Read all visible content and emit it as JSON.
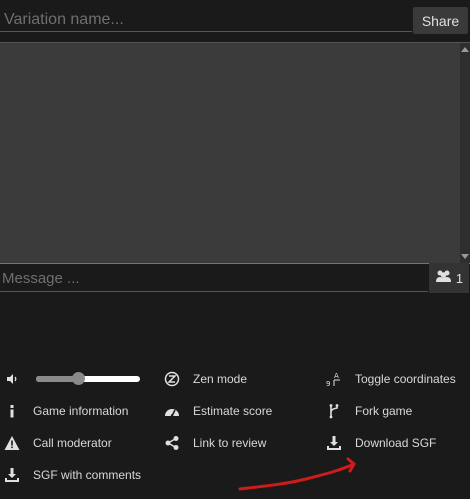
{
  "variation": {
    "placeholder": "Variation name...",
    "share_label": "Share"
  },
  "chat": {
    "message_placeholder": "Message ...",
    "user_count": "1"
  },
  "controls": {
    "zen_mode": "Zen mode",
    "toggle_coordinates": "Toggle coordinates",
    "game_information": "Game information",
    "estimate_score": "Estimate score",
    "fork_game": "Fork game",
    "call_moderator": "Call moderator",
    "link_to_review": "Link to review",
    "download_sgf": "Download SGF",
    "sgf_with_comments": "SGF with comments",
    "volume_level": 0.4
  },
  "colors": {
    "annotation_red": "#d11b1b",
    "chat_border": "#38a03a"
  }
}
